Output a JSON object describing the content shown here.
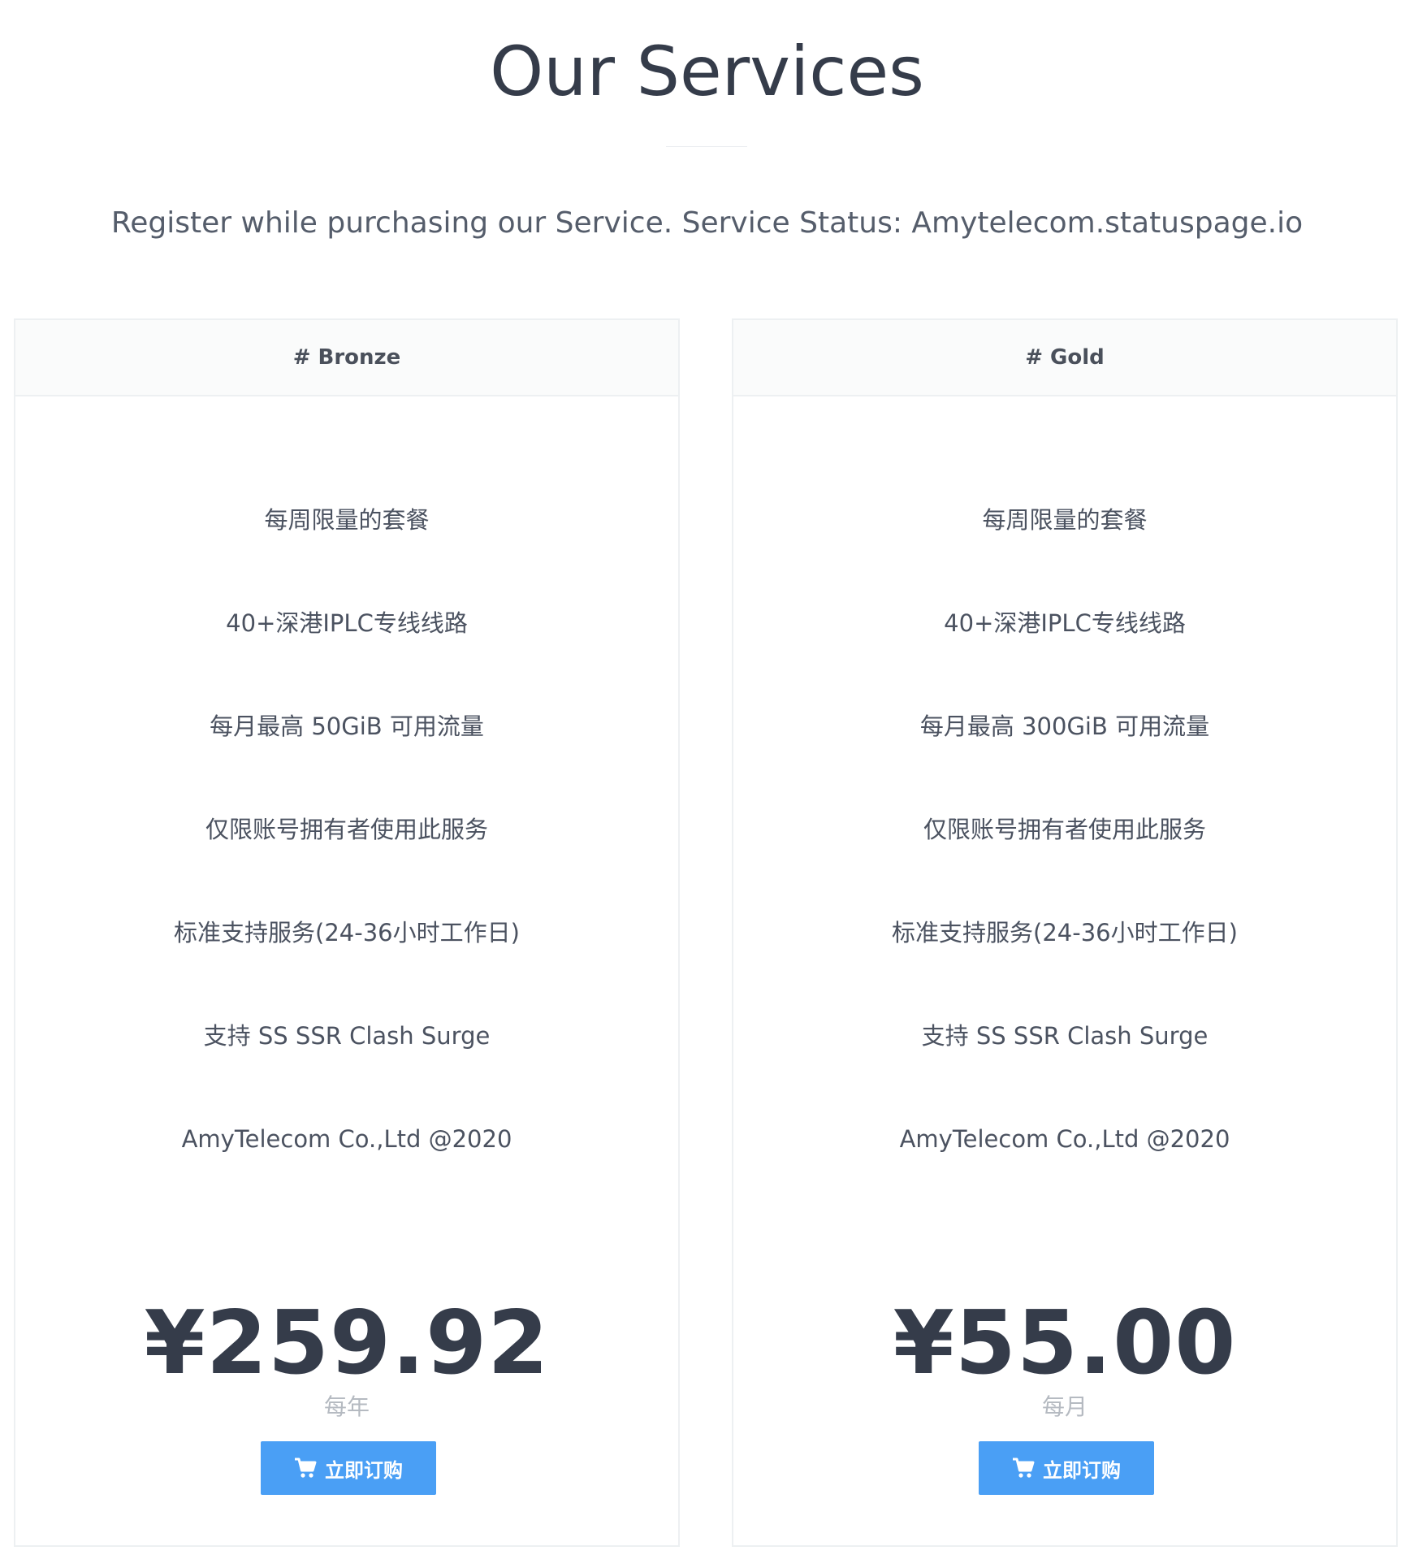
{
  "header": {
    "title": "Our Services",
    "subtitle": "Register while purchasing our Service. Service Status: Amytelecom.statuspage.io"
  },
  "plans": [
    {
      "name": "# Bronze",
      "features": [
        "每周限量的套餐",
        "40+深港IPLC专线线路",
        "每月最高 50GiB 可用流量",
        "仅限账号拥有者使用此服务",
        "标准支持服务(24-36小时工作日)",
        "支持 SS SSR Clash Surge",
        "AmyTelecom Co.,Ltd @2020"
      ],
      "price": "¥259.92",
      "period": "每年",
      "button_label": "立即订购",
      "button_icon": "cart-icon"
    },
    {
      "name": "# Gold",
      "features": [
        "每周限量的套餐",
        "40+深港IPLC专线线路",
        "每月最高 300GiB 可用流量",
        "仅限账号拥有者使用此服务",
        "标准支持服务(24-36小时工作日)",
        "支持 SS SSR Clash Surge",
        "AmyTelecom Co.,Ltd @2020"
      ],
      "price": "¥55.00",
      "period": "每月",
      "button_label": "立即订购",
      "button_icon": "cart-icon"
    }
  ],
  "colors": {
    "button": "#4a9ff5",
    "text_dark": "#353c4a",
    "period_text": "#b5bac1"
  }
}
